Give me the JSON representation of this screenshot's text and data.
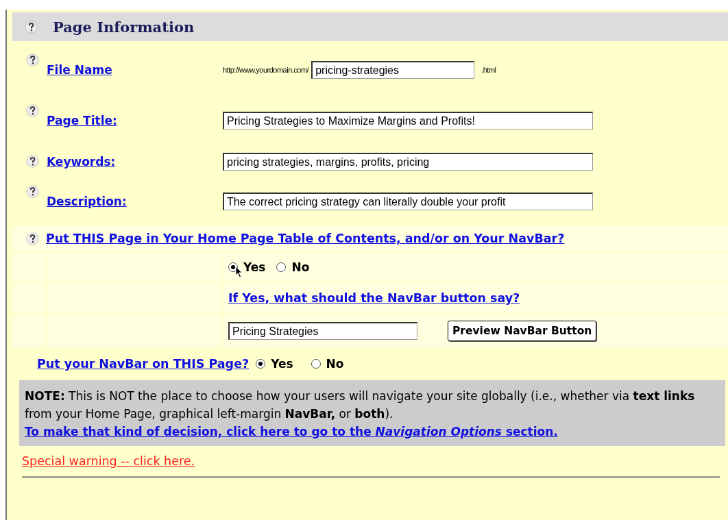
{
  "header": {
    "title": "Page Information"
  },
  "fields": [
    {
      "kind": "url",
      "label": "File Name",
      "prefix": "http://www.yourdomain.com/",
      "value": "pricing-strategies",
      "suffix": ".html"
    },
    {
      "kind": "text",
      "label": "Page Title:",
      "value": "Pricing Strategies to Maximize Margins and Profits!"
    },
    {
      "kind": "text",
      "label": "Keywords:",
      "value": "pricing strategies, margins, profits, pricing"
    },
    {
      "kind": "text",
      "label": "Description:",
      "value": "The correct pricing strategy can literally double your profit"
    }
  ],
  "toc": {
    "question": "Put THIS Page in Your Home Page Table of Contents, and/or on Your NavBar?",
    "options": [
      {
        "label": "Yes",
        "selected": true
      },
      {
        "label": "No",
        "selected": false
      }
    ],
    "navbar_question": "If Yes, what should the NavBar button say?",
    "navbar_text": "Pricing Strategies",
    "preview_button": "Preview NavBar Button"
  },
  "navbar_on_page": {
    "question": "Put your NavBar on THIS Page?",
    "options": [
      {
        "label": "Yes",
        "selected": true
      },
      {
        "label": "No",
        "selected": false
      }
    ]
  },
  "note": {
    "text": "**NOTE:** This is NOT the place to choose how your users will navigate your site globally (i.e., whether via **text links** from your Home Page, graphical left-margin **NavBar,** or **both**).",
    "link": "To make that kind of decision, click here to go to the *Navigation Options* section."
  },
  "warning_link": "Special warning -- click here."
}
